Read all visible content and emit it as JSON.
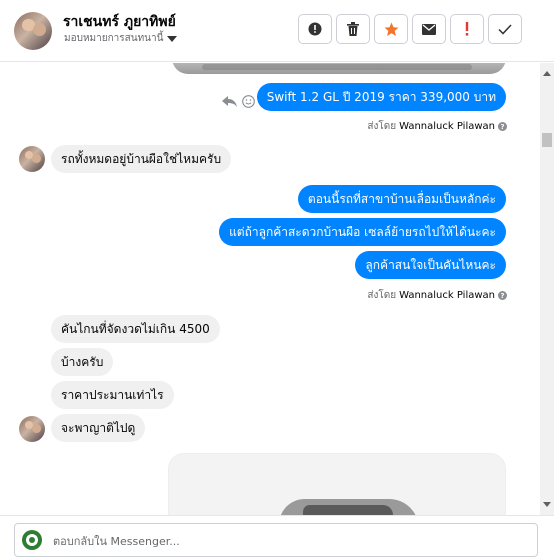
{
  "header": {
    "name": "ราเชนทร์ ภูยาทิพย์",
    "assign_label": "มอบหมายการสนทนานี้",
    "buttons": {
      "info": "info-icon",
      "delete": "trash-icon",
      "star": "star-icon",
      "mail": "envelope-icon",
      "important": "exclamation-icon",
      "done": "check-icon"
    },
    "star_color": "#f2752f",
    "important_color": "#e53935"
  },
  "messages": {
    "m1": "Swift 1.2 GL   ปี 2019  ราคา 339,000 บาท",
    "sent_by_1_prefix": "ส่งโดย",
    "sent_by_1_name": "Wannaluck Pilawan",
    "m2": "รถทั้งหมดอยู่บ้านผือใช่ไหมครับ",
    "m3": "ตอนนี้รถที่สาขาบ้านเลื่อมเป็นหลักค่ะ",
    "m4": "แต่ถ้าลูกค้าสะดวกบ้านผือ เซลล์ย้ายรถไปให้ได้นะคะ",
    "m5": "ลูกค้าสนใจเป็นคันไหนคะ",
    "sent_by_2_prefix": "ส่งโดย",
    "sent_by_2_name": "Wannaluck Pilawan",
    "m6": "คันไกนที่จัดงวดไม่เกิน 4500",
    "m7": "บ้างครับ",
    "m8": "ราคาประมานเท่าไร",
    "m9": "จะพาญาติไปดู",
    "help": "?"
  },
  "composer": {
    "placeholder": "ตอบกลับใน Messenger..."
  },
  "colors": {
    "outgoing": "#0084ff",
    "incoming": "#f0f0f0"
  }
}
